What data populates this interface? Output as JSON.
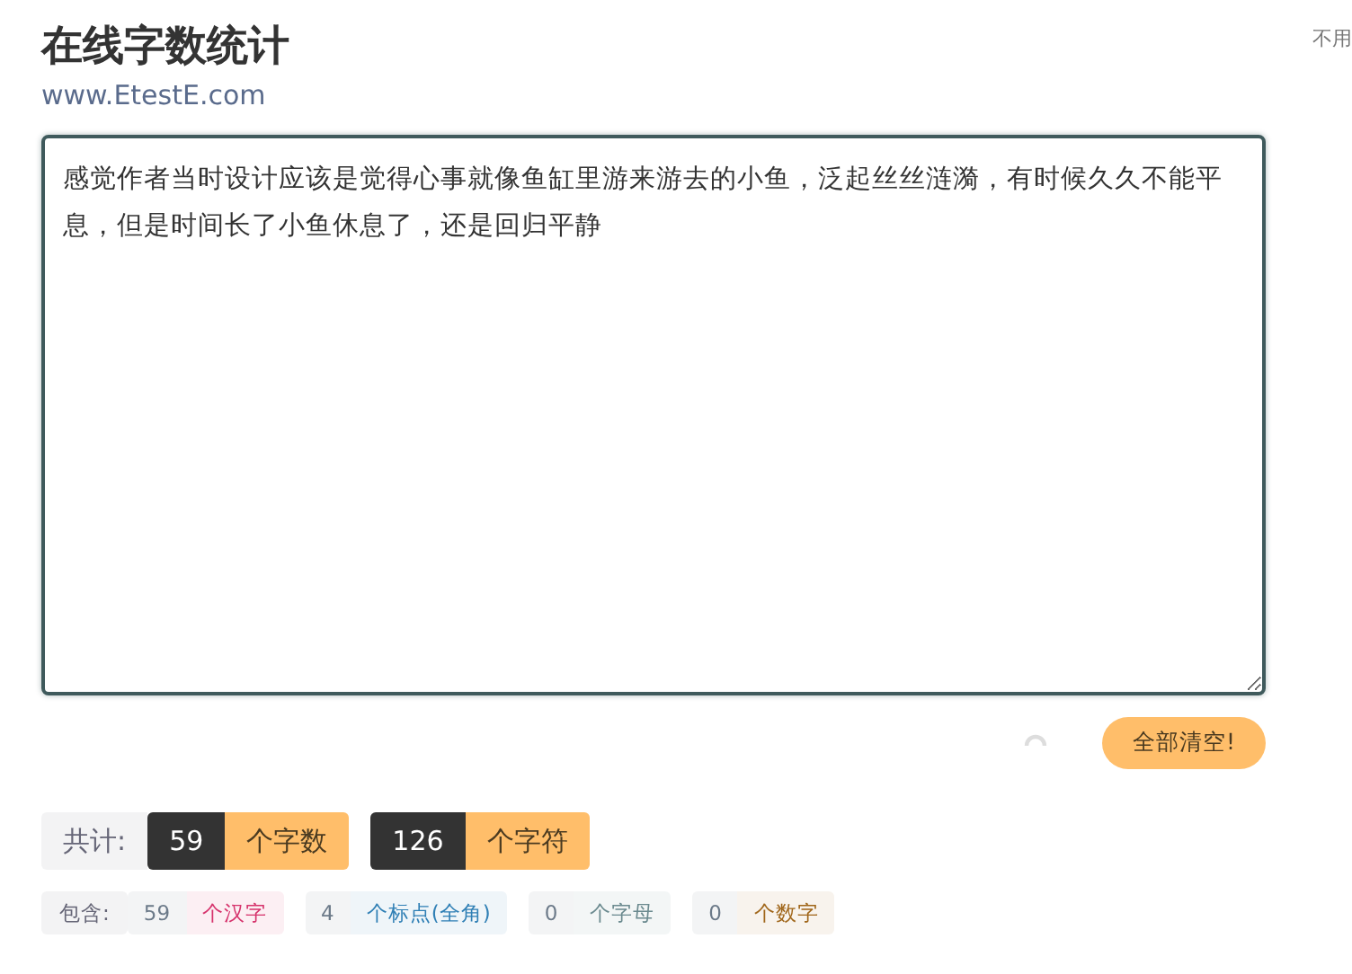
{
  "header": {
    "title": "在线字数统计",
    "url": "www.EtestE.com",
    "side_note": "不用"
  },
  "editor": {
    "value": "感觉作者当时设计应该是觉得心事就像鱼缸里游来游去的小鱼，泛起丝丝涟漪，有时候久久不能平息，但是时间长了小鱼休息了，还是回归平静"
  },
  "clear_button": "全部清空!",
  "totals": {
    "label": "共计:",
    "items": [
      {
        "count": "59",
        "unit": "个字数"
      },
      {
        "count": "126",
        "unit": "个字符"
      }
    ]
  },
  "breakdown": {
    "label": "包含:",
    "items": [
      {
        "count": "59",
        "unit": "个汉字",
        "color": "#d6336c"
      },
      {
        "count": "4",
        "unit": "个标点(全角)",
        "color": "#2f7fb5"
      },
      {
        "count": "0",
        "unit": "个字母",
        "color": "#6b8a8f"
      },
      {
        "count": "0",
        "unit": "个数字",
        "color": "#a0661a"
      }
    ]
  }
}
